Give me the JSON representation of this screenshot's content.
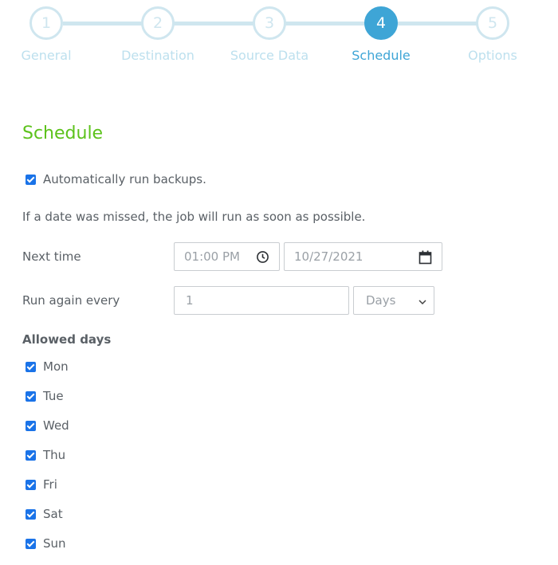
{
  "stepper": {
    "steps": [
      {
        "number": "1",
        "label": "General"
      },
      {
        "number": "2",
        "label": "Destination"
      },
      {
        "number": "3",
        "label": "Source Data"
      },
      {
        "number": "4",
        "label": "Schedule"
      },
      {
        "number": "5",
        "label": "Options"
      }
    ],
    "active_step": 4
  },
  "schedule": {
    "title": "Schedule",
    "auto_run_label": "Automatically run backups.",
    "auto_run_checked": true,
    "missed_note": "If a date was missed, the job will run as soon as possible.",
    "next_time_label": "Next time",
    "next_time_value": "01:00 PM",
    "next_date_value": "10/27/2021",
    "run_again_label": "Run again every",
    "run_again_value": "1",
    "run_again_unit": "Days",
    "allowed_days_heading": "Allowed days",
    "days": [
      {
        "label": "Mon",
        "checked": true
      },
      {
        "label": "Tue",
        "checked": true
      },
      {
        "label": "Wed",
        "checked": true
      },
      {
        "label": "Thu",
        "checked": true
      },
      {
        "label": "Fri",
        "checked": true
      },
      {
        "label": "Sat",
        "checked": true
      },
      {
        "label": "Sun",
        "checked": true
      }
    ]
  },
  "colors": {
    "accent_blue": "#3ea5d6",
    "title_green": "#5cc21b",
    "checkbox_blue": "#1a73e8",
    "inactive_step": "#cfe6ef"
  },
  "icons": {
    "time": "clock-icon",
    "date": "calendar-icon",
    "select": "chevron-down-icon"
  }
}
